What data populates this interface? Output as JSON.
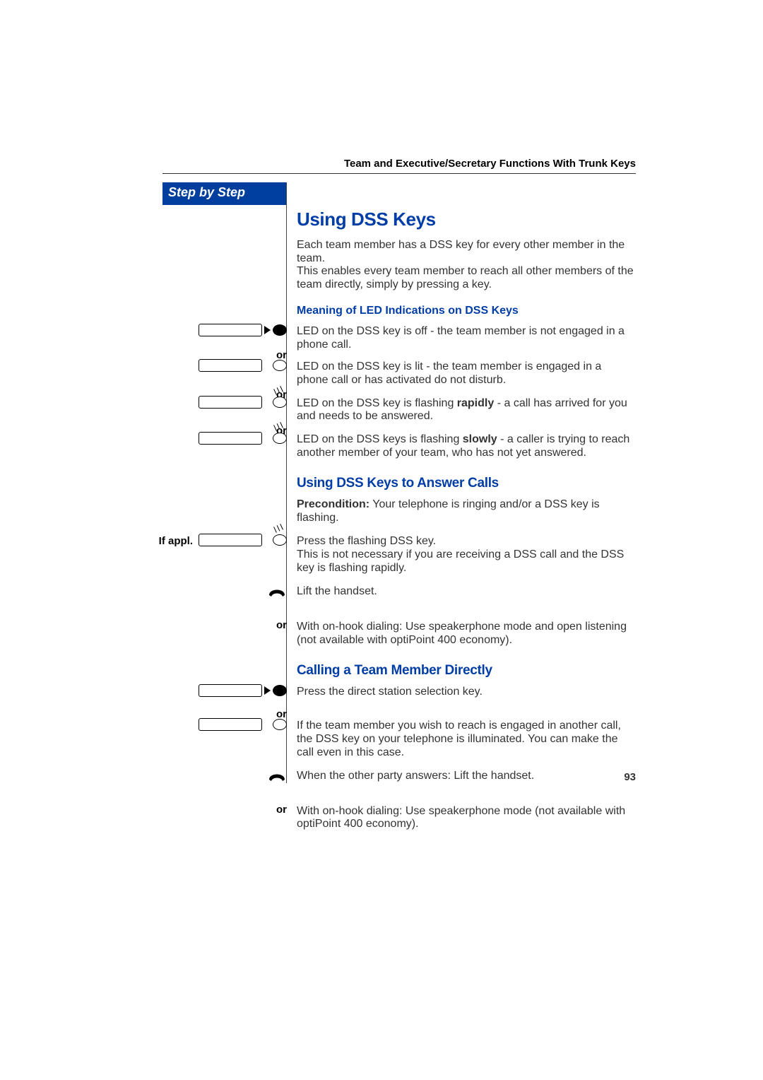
{
  "header": {
    "running_head": "Team and Executive/Secretary Functions With Trunk Keys"
  },
  "sidebar": {
    "title": "Step by Step"
  },
  "labels": {
    "or": "or",
    "if_appl": "If appl."
  },
  "content": {
    "title": "Using DSS Keys",
    "intro": "Each team member has a DSS key for every other member in the team.\nThis enables every team member to reach all other members of the team directly, simply by pressing a key.",
    "led_heading": "Meaning of LED Indications on DSS Keys",
    "led_off": "LED on the DSS key is off - the team member is not engaged in a phone call.",
    "led_on": "LED on the DSS key is lit - the team member is engaged in a phone call or has activated do not disturb.",
    "led_rapid_pre": "LED on the DSS key is flashing ",
    "led_rapid_bold": "rapidly",
    "led_rapid_post": " - a call has arrived for you and needs to be answered.",
    "led_slow_pre": "LED on the DSS keys is flashing ",
    "led_slow_bold": "slowly",
    "led_slow_post": " - a caller is trying to reach another member of your team, who has not yet answered.",
    "answer_heading": "Using DSS Keys to Answer Calls",
    "answer_pre_bold": "Precondition:",
    "answer_precond": " Your telephone is ringing and/or a DSS key is flashing.",
    "answer_press": "Press the flashing DSS key.\nThis is not necessary if you are receiving a DSS call and the DSS key is flashing rapidly.",
    "answer_lift": "Lift the handset.",
    "answer_onhook": "With on-hook dialing: Use speakerphone mode and open listening (not available with optiPoint 400 economy).",
    "call_heading": "Calling a Team Member Directly",
    "call_press": "Press the direct station selection key.",
    "call_busy": "If the team member you wish to reach is engaged in another call, the DSS key on your telephone is illuminated. You can make the call even in this case.",
    "call_lift": "When the other party answers: Lift the handset.",
    "call_onhook": "With on-hook dialing: Use speakerphone mode (not available with optiPoint 400 economy)."
  },
  "page_number": "93"
}
